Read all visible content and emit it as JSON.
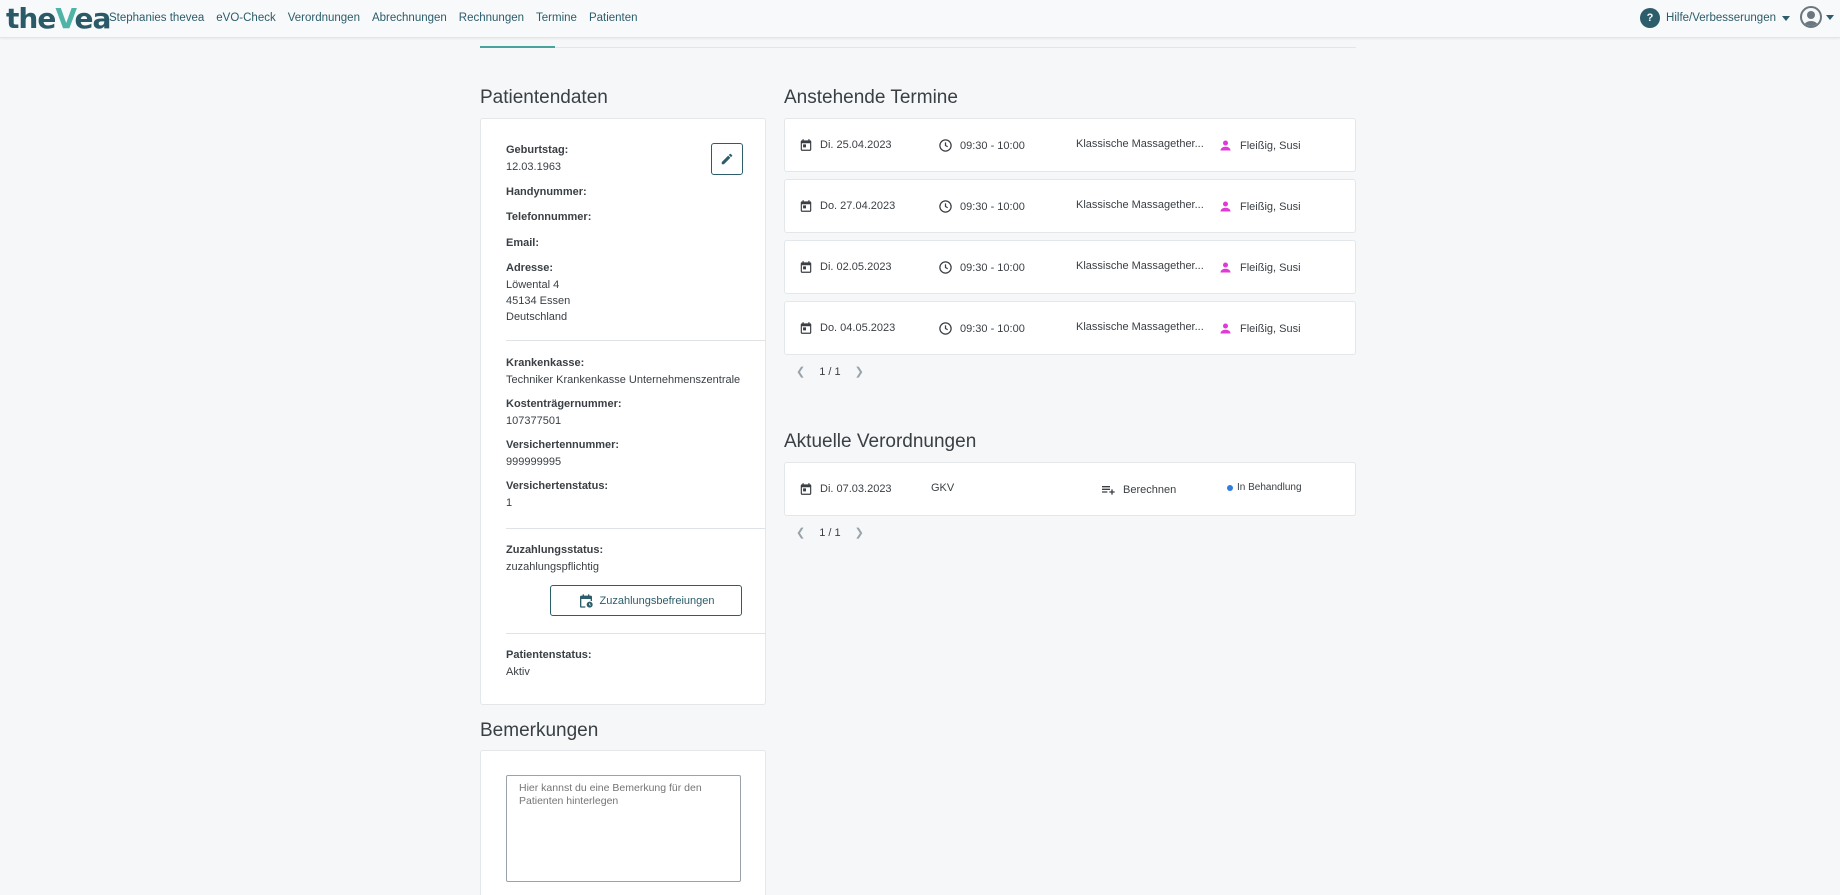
{
  "brand": {
    "logo_pre": "the",
    "logo_v": "V",
    "logo_post": "ea"
  },
  "nav": [
    "Stephanies thevea",
    "eVO-Check",
    "Verordnungen",
    "Abrechnungen",
    "Rechnungen",
    "Termine",
    "Patienten"
  ],
  "help": {
    "label": "Hilfe/Verbesserungen",
    "icon": "question-icon"
  },
  "patient": {
    "title": "Patientendaten",
    "birthday": {
      "label": "Geburtstag:",
      "value": "12.03.1963"
    },
    "mobile": {
      "label": "Handynummer:"
    },
    "phone": {
      "label": "Telefonnummer:"
    },
    "email": {
      "label": "Email:"
    },
    "address": {
      "label": "Adresse:",
      "line1": "Löwental 4",
      "line2": "45134 Essen",
      "line3": "Deutschland"
    },
    "insurance": {
      "label": "Krankenkasse:",
      "value": "Techniker Krankenkasse Unternehmenszentrale"
    },
    "cost_carrier": {
      "label": "Kostenträgernummer:",
      "value": "107377501"
    },
    "insured_no": {
      "label": "Versichertennummer:",
      "value": "999999995"
    },
    "insured_status": {
      "label": "Versichertenstatus:",
      "value": "1"
    },
    "copay_status": {
      "label": "Zuzahlungsstatus:",
      "value": "zuzahlungspflichtig"
    },
    "copay_button": "Zuzahlungsbefreiungen",
    "patient_status": {
      "label": "Patientenstatus:",
      "value": "Aktiv"
    }
  },
  "remarks": {
    "title": "Bemerkungen",
    "placeholder": "Hier kannst du eine Bemerkung für den Patienten hinterlegen"
  },
  "appointments": {
    "title": "Anstehende Termine",
    "items": [
      {
        "date": "Di. 25.04.2023",
        "time": "09:30 - 10:00",
        "treatment": "Klassische Massagether...",
        "therapist": "Fleißig, Susi"
      },
      {
        "date": "Do. 27.04.2023",
        "time": "09:30 - 10:00",
        "treatment": "Klassische Massagether...",
        "therapist": "Fleißig, Susi"
      },
      {
        "date": "Di. 02.05.2023",
        "time": "09:30 - 10:00",
        "treatment": "Klassische Massagether...",
        "therapist": "Fleißig, Susi"
      },
      {
        "date": "Do. 04.05.2023",
        "time": "09:30 - 10:00",
        "treatment": "Klassische Massagether...",
        "therapist": "Fleißig, Susi"
      }
    ],
    "pager": "1 / 1"
  },
  "prescriptions": {
    "title": "Aktuelle Verordnungen",
    "items": [
      {
        "date": "Di. 07.03.2023",
        "type": "GKV",
        "action": "Berechnen",
        "status": "In Behandlung"
      }
    ],
    "pager": "1 / 1"
  },
  "colors": {
    "primary": "#2b5d6b",
    "accent": "#4fb3a8",
    "therapist_icon": "#e03ad6",
    "status_dot": "#2f7de1"
  }
}
